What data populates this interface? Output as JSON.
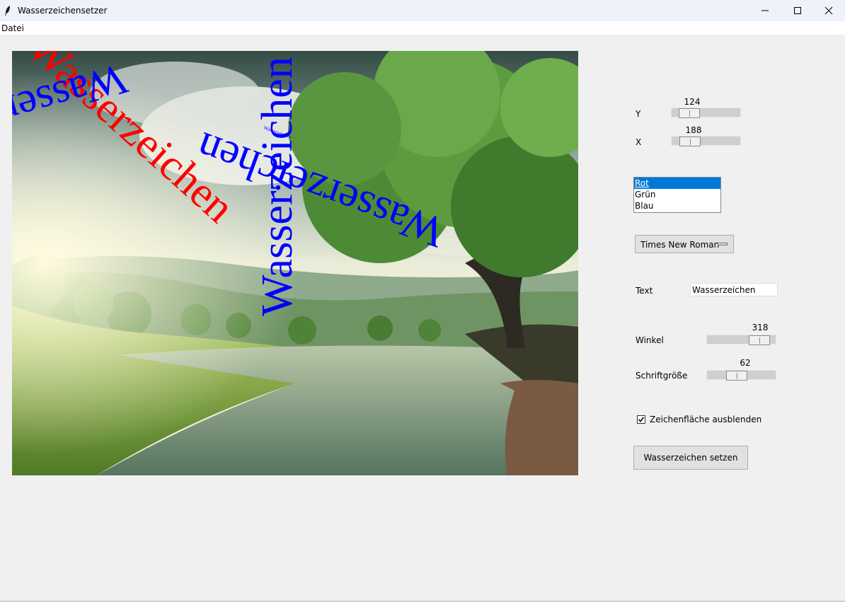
{
  "window": {
    "title": "Wasserzeichensetzer",
    "controls": [
      "minimize",
      "maximize",
      "close"
    ]
  },
  "menu": {
    "items": [
      "Datei"
    ]
  },
  "canvas": {
    "image_description": "river landscape with large tree",
    "watermarks": [
      {
        "text": "Wasserzeichen",
        "color": "#ff0000"
      },
      {
        "text": "Wasserzeichen",
        "color": "#0000ff"
      },
      {
        "text": "Wasserzeichen",
        "color": "#0000ff"
      },
      {
        "text": "Wasserzeichen",
        "color": "#0000ff"
      },
      {
        "text": "Wasserzeichen",
        "color": "#0000ff"
      }
    ]
  },
  "controls": {
    "y": {
      "label": "Y",
      "value": "124",
      "fraction": 0.15
    },
    "x": {
      "label": "X",
      "value": "188",
      "fraction": 0.16
    },
    "color_list": {
      "options": [
        "Rot",
        "Grün",
        "Blau"
      ],
      "selected": "Rot"
    },
    "font_menu": {
      "value": "Times New Roman"
    },
    "text": {
      "label": "Text",
      "value": "Wasserzeichen"
    },
    "angle": {
      "label": "Winkel",
      "value": "318",
      "fraction": 0.88
    },
    "font_size": {
      "label": "Schriftgröße",
      "value": "62",
      "fraction": 0.4
    },
    "hide_canvas": {
      "label": "Zeichenfläche ausblenden",
      "checked": true
    },
    "apply_button": "Wasserzeichen setzen"
  },
  "colors": {
    "accent": "#0078d7",
    "watermark_red": "#ff0000",
    "watermark_blue": "#0000ff"
  }
}
